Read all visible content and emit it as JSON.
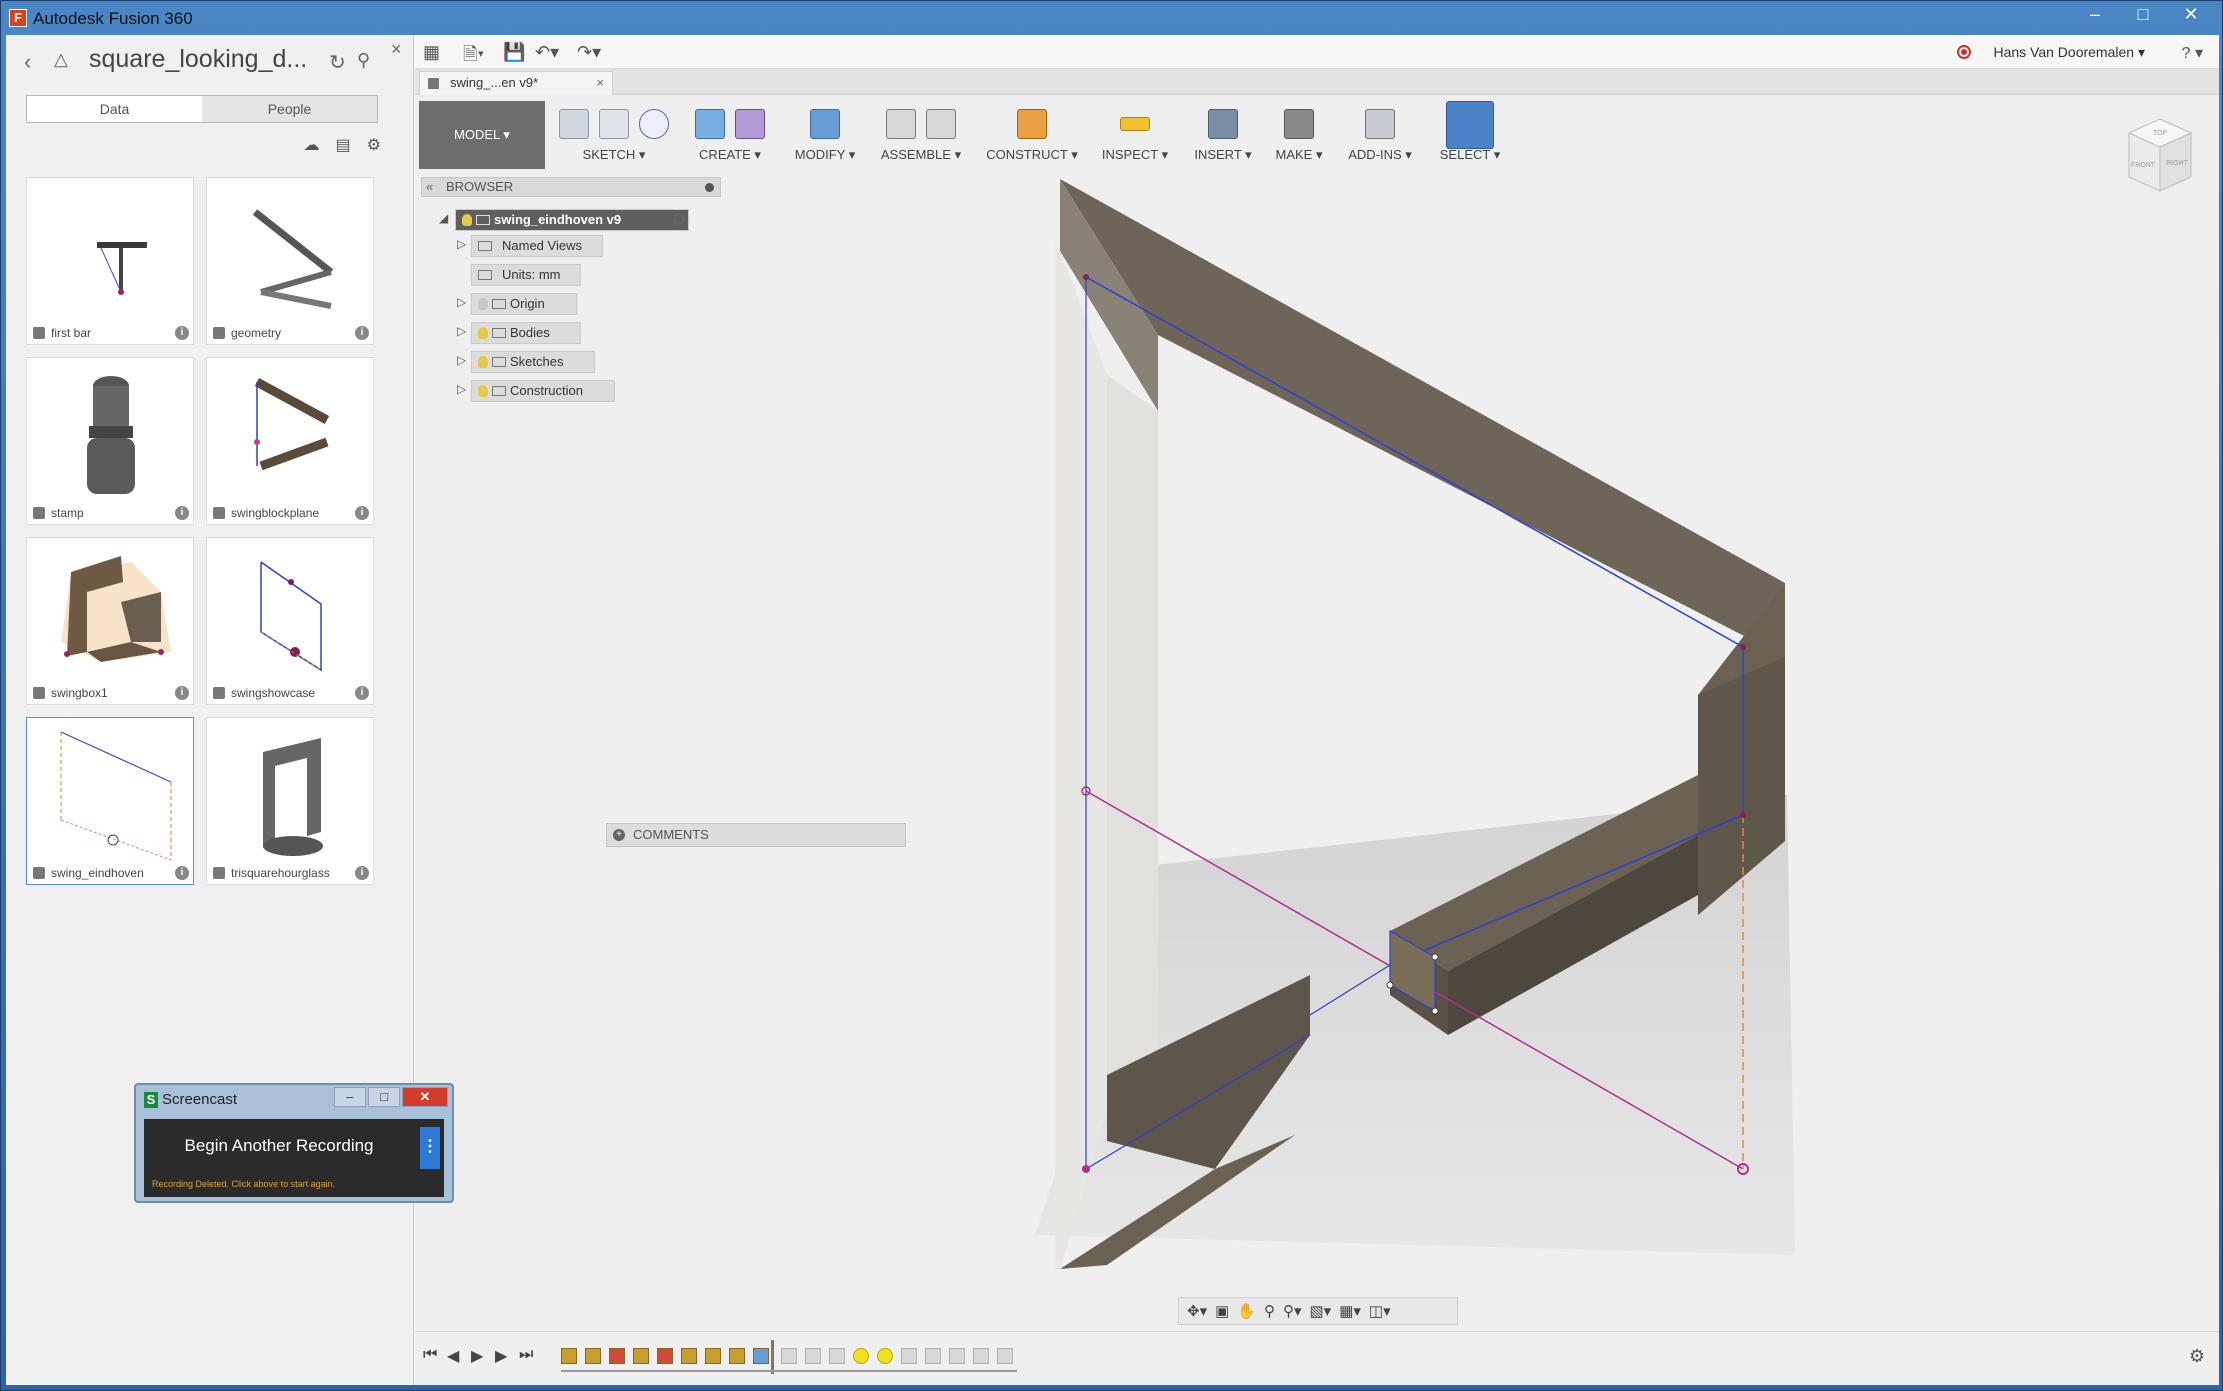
{
  "window": {
    "title": "Autodesk Fusion 360",
    "app_icon": "F",
    "buttons": [
      "minimize",
      "maximize",
      "close"
    ]
  },
  "data_panel": {
    "project_title": "square_looking_d...",
    "tabs": [
      {
        "label": "Data",
        "active": true
      },
      {
        "label": "People",
        "active": false
      }
    ],
    "items": [
      {
        "name": "first bar"
      },
      {
        "name": "geometry"
      },
      {
        "name": "stamp"
      },
      {
        "name": "swingblockplane"
      },
      {
        "name": "swingbox1"
      },
      {
        "name": "swingshowcase"
      },
      {
        "name": "swing_eindhoven",
        "selected": true
      },
      {
        "name": "trisquarehourglass"
      }
    ]
  },
  "screencast": {
    "title": "Screencast",
    "record_button": "Begin Another Recording",
    "status": "Recording Deleted. Click above to start again."
  },
  "appbar": {
    "user": "Hans Van Dooremalen",
    "help": "?"
  },
  "doc_tab": {
    "label": "swing_...en v9*"
  },
  "toolbar": {
    "workspace": "MODEL",
    "groups": [
      {
        "label": "SKETCH",
        "icons": [
          "sketch-icon",
          "rectangle-icon",
          "circle-icon"
        ]
      },
      {
        "label": "CREATE",
        "icons": [
          "box-icon",
          "form-icon"
        ]
      },
      {
        "label": "MODIFY",
        "icons": [
          "press-pull-icon"
        ]
      },
      {
        "label": "ASSEMBLE",
        "icons": [
          "component-icon",
          "joint-icon"
        ]
      },
      {
        "label": "CONSTRUCT",
        "icons": [
          "plane-icon"
        ]
      },
      {
        "label": "INSPECT",
        "icons": [
          "measure-icon"
        ]
      },
      {
        "label": "INSERT",
        "icons": [
          "image-icon"
        ]
      },
      {
        "label": "MAKE",
        "icons": [
          "print-icon"
        ]
      },
      {
        "label": "ADD-INS",
        "icons": [
          "scripts-icon"
        ]
      },
      {
        "label": "SELECT",
        "icons": [
          "select-icon"
        ]
      }
    ]
  },
  "browser": {
    "title": "BROWSER",
    "root": "swing_eindhoven v9",
    "nodes": [
      "Named Views",
      "Units: mm",
      "Origin",
      "Bodies",
      "Sketches",
      "Construction"
    ]
  },
  "comments": {
    "label": "COMMENTS"
  },
  "viewcube": {
    "faces": [
      "TOP",
      "FRONT",
      "RIGHT"
    ]
  },
  "colors": {
    "accent": "#4c82c6",
    "body_dark": "#6e6558",
    "sketch_line": "#2a3fd8",
    "construction": "#b03090"
  }
}
